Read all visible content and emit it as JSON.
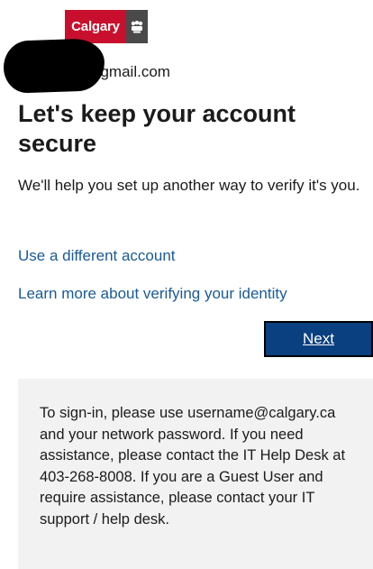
{
  "header": {
    "logo_text": "Calgary",
    "logo_crest_icon": "city-crest-icon"
  },
  "account": {
    "email": "dcctest743@gmail.com"
  },
  "main": {
    "title": "Let's keep your account secure",
    "description": "We'll help you set up another way to verify it's you.",
    "links": [
      "Use a different account",
      "Learn more about verifying your identity"
    ],
    "next_label": "Next"
  },
  "info_box": {
    "text": "To sign-in, please use username@calgary.ca and your network password. If you need assistance, please contact the IT Help Desk at 403-268-8008. If you are a Guest User and require assistance, please contact your IT support / help desk."
  },
  "colors": {
    "brand_red": "#c8102e",
    "link_blue": "#1a5a96",
    "button_blue": "#0a4080",
    "info_bg": "#f2f2f2"
  }
}
